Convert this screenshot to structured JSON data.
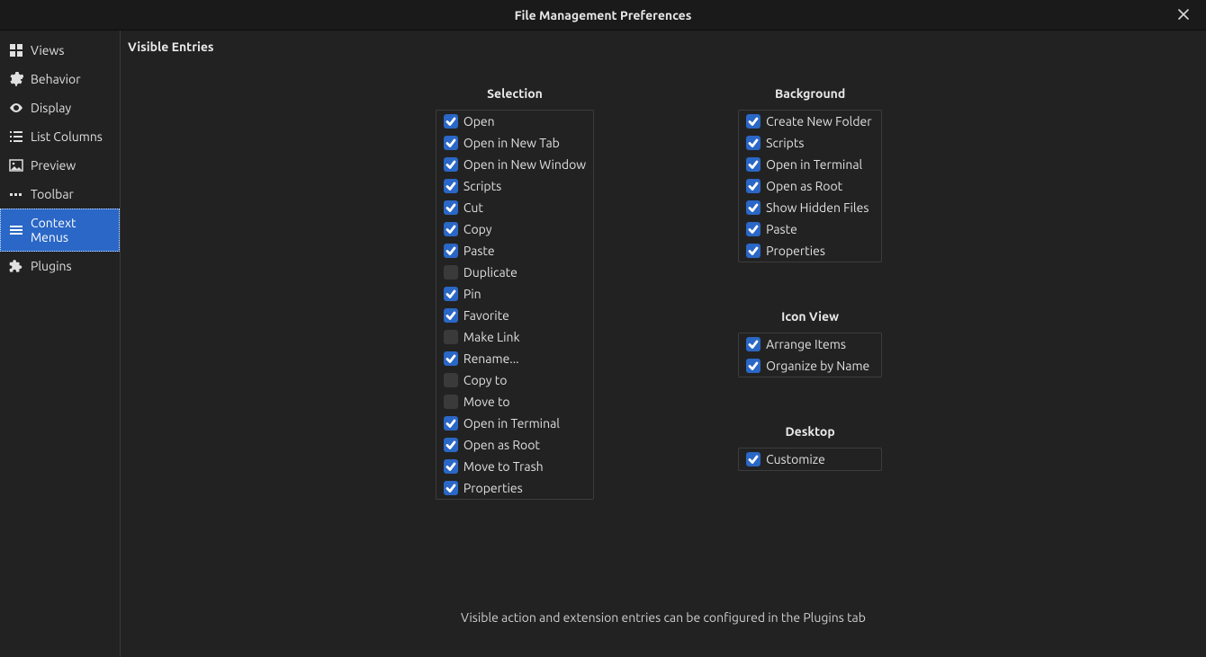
{
  "window": {
    "title": "File Management Preferences"
  },
  "sidebar": {
    "items": [
      {
        "id": "views",
        "label": "Views",
        "icon": "grid-icon"
      },
      {
        "id": "behavior",
        "label": "Behavior",
        "icon": "gear-icon"
      },
      {
        "id": "display",
        "label": "Display",
        "icon": "eye-icon"
      },
      {
        "id": "list-columns",
        "label": "List Columns",
        "icon": "list-icon"
      },
      {
        "id": "preview",
        "label": "Preview",
        "icon": "image-icon"
      },
      {
        "id": "toolbar",
        "label": "Toolbar",
        "icon": "dots-icon"
      },
      {
        "id": "context-menus",
        "label": "Context Menus",
        "icon": "menu-icon"
      },
      {
        "id": "plugins",
        "label": "Plugins",
        "icon": "puzzle-icon"
      }
    ],
    "active": "context-menus"
  },
  "main": {
    "heading": "Visible Entries",
    "footer": "Visible action and extension entries can be configured in the Plugins tab",
    "groups": {
      "selection": {
        "title": "Selection",
        "items": [
          {
            "label": "Open",
            "checked": true
          },
          {
            "label": "Open in New Tab",
            "checked": true
          },
          {
            "label": "Open in New Window",
            "checked": true
          },
          {
            "label": "Scripts",
            "checked": true
          },
          {
            "label": "Cut",
            "checked": true
          },
          {
            "label": "Copy",
            "checked": true
          },
          {
            "label": "Paste",
            "checked": true
          },
          {
            "label": "Duplicate",
            "checked": false
          },
          {
            "label": "Pin",
            "checked": true
          },
          {
            "label": "Favorite",
            "checked": true
          },
          {
            "label": "Make Link",
            "checked": false
          },
          {
            "label": "Rename...",
            "checked": true
          },
          {
            "label": "Copy to",
            "checked": false
          },
          {
            "label": "Move to",
            "checked": false
          },
          {
            "label": "Open in Terminal",
            "checked": true
          },
          {
            "label": "Open as Root",
            "checked": true
          },
          {
            "label": "Move to Trash",
            "checked": true
          },
          {
            "label": "Properties",
            "checked": true
          }
        ]
      },
      "background": {
        "title": "Background",
        "items": [
          {
            "label": "Create New Folder",
            "checked": true
          },
          {
            "label": "Scripts",
            "checked": true
          },
          {
            "label": "Open in Terminal",
            "checked": true
          },
          {
            "label": "Open as Root",
            "checked": true
          },
          {
            "label": "Show Hidden Files",
            "checked": true
          },
          {
            "label": "Paste",
            "checked": true
          },
          {
            "label": "Properties",
            "checked": true
          }
        ]
      },
      "icon_view": {
        "title": "Icon View",
        "items": [
          {
            "label": "Arrange Items",
            "checked": true
          },
          {
            "label": "Organize by Name",
            "checked": true
          }
        ]
      },
      "desktop": {
        "title": "Desktop",
        "items": [
          {
            "label": "Customize",
            "checked": true
          }
        ]
      }
    }
  }
}
